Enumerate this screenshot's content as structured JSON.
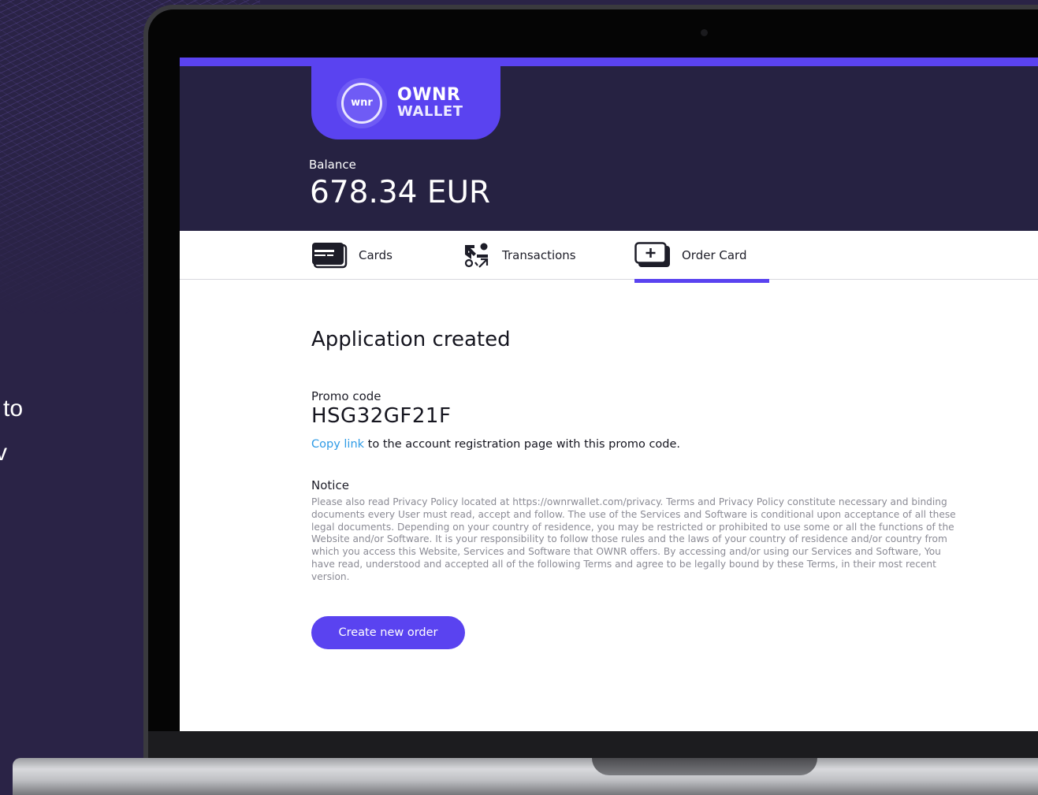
{
  "background": {
    "side_text": [
      "to",
      "v"
    ],
    "colors": {
      "page": "#2a2346",
      "accent": "#5a43f0",
      "header": "#262242"
    }
  },
  "app": {
    "logo": {
      "mark": "wnr",
      "line1": "OWNR",
      "line2": "WALLET"
    },
    "balance": {
      "label": "Balance",
      "value": "678.34 EUR"
    },
    "tabs": [
      {
        "label": "Cards",
        "icon": "credit-card-icon",
        "active": false
      },
      {
        "label": "Transactions",
        "icon": "transactions-icon",
        "active": false
      },
      {
        "label": "Order Card",
        "icon": "add-card-icon",
        "active": true
      }
    ],
    "content": {
      "title": "Application created",
      "promo_label": "Promo code",
      "promo_code": "HSG32GF21F",
      "copy_link_text": "Copy link",
      "copy_rest": " to the account registration page with this promo code.",
      "notice_label": "Notice",
      "notice_text": "Please also read Privacy Policy located at https://ownrwallet.com/privacy. Terms and Privacy Policy constitute necessary and binding documents every User must read, accept and follow. The use of the Services and Software is conditional upon acceptance of all these legal documents. Depending on your country of residence, you may be restricted or prohibited to use some or all the functions of the Website and/or Software. It is your responsibility to follow those rules and the laws of your country of residence and/or country from which you access this Website, Services and Software that OWNR offers. By accessing and/or using our Services and Software, You have read, understood and accepted all of the following Terms and agree to be legally bound by these Terms, in their most recent version.",
      "create_button": "Create new order"
    }
  }
}
